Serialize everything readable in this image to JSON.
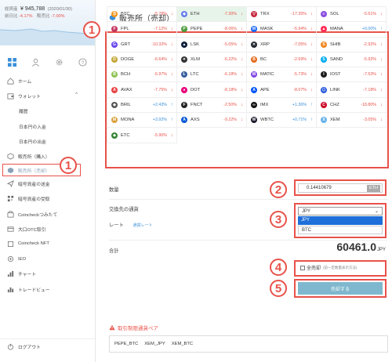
{
  "sidebar": {
    "total_label": "総資産",
    "total_value": "¥ 945,788",
    "total_date": "(2020/01/30)",
    "change_label": "前日比",
    "change_value": "-4.17%",
    "sales_label": "販売比",
    "sales_value": "-7.00%",
    "nav": [
      {
        "label": "ホーム",
        "icon": "home-icon"
      },
      {
        "label": "ウォレット",
        "icon": "wallet-icon",
        "expanded": true
      },
      {
        "label": "履歴",
        "sub": true
      },
      {
        "label": "日本円の入金",
        "sub": true
      },
      {
        "label": "日本円の出金",
        "sub": true
      },
      {
        "label": "販売所（購入）",
        "icon": "cube-icon"
      },
      {
        "label": "販売所（売却）",
        "icon": "cube-icon",
        "active": true
      },
      {
        "label": "暗号資産の送金",
        "icon": "send-icon"
      },
      {
        "label": "暗号資産の受取",
        "icon": "qr-icon"
      },
      {
        "label": "Coincheckつみたて",
        "icon": "savings-icon"
      },
      {
        "label": "大口OTC取引",
        "icon": "otc-icon"
      },
      {
        "label": "Coincheck NFT",
        "icon": "nft-icon"
      },
      {
        "label": "IEO",
        "icon": "ieo-icon"
      },
      {
        "label": "チャート",
        "icon": "chart-icon"
      },
      {
        "label": "トレードビュー",
        "icon": "tradeview-icon"
      }
    ],
    "logout": "ログアウト",
    "wallet_chevron": "^"
  },
  "badges": {
    "b1": "1",
    "b1s": "1",
    "b2": "2",
    "b3": "3",
    "b4": "4",
    "b5": "5"
  },
  "main": {
    "title": "販売所（売却）",
    "coins": [
      {
        "sym": "BTC",
        "chg": "-5.78%",
        "dir": "neg",
        "color": "#f7931a",
        "glyph": "₿"
      },
      {
        "sym": "ETH",
        "chg": "-7.30%",
        "dir": "neg",
        "color": "#627eea",
        "glyph": "◆",
        "selected": true
      },
      {
        "sym": "TRX",
        "chg": "-17.35%",
        "dir": "neg",
        "color": "#c4283f",
        "glyph": "▽"
      },
      {
        "sym": "SOL",
        "chg": "-5.61%",
        "dir": "neg",
        "color": "#8a4fe0",
        "glyph": "≡"
      },
      {
        "sym": "FPL",
        "chg": "-7.12%",
        "dir": "neg",
        "color": "#c4375e",
        "glyph": "F"
      },
      {
        "sym": "PEPE",
        "chg": "-8.06%",
        "dir": "neg",
        "color": "#4a9a3a",
        "glyph": "P"
      },
      {
        "sym": "MASK",
        "chg": "-5.94%",
        "dir": "neg",
        "color": "#1c68f3",
        "glyph": "M"
      },
      {
        "sym": "MANA",
        "chg": "+0.00%",
        "dir": "pos",
        "color": "#ff2d55",
        "glyph": "▲"
      },
      {
        "sym": "GRT",
        "chg": "-10.32%",
        "dir": "neg",
        "color": "#6747ed",
        "glyph": "G"
      },
      {
        "sym": "LSK",
        "chg": "-5.05%",
        "dir": "neg",
        "color": "#0d1e3a",
        "glyph": "▲"
      },
      {
        "sym": "XRP",
        "chg": "-7.05%",
        "dir": "neg",
        "color": "#23292f",
        "glyph": "✕"
      },
      {
        "sym": "SHIB",
        "chg": "-2.92%",
        "dir": "neg",
        "color": "#f0871f",
        "glyph": "S"
      },
      {
        "sym": "DOGE",
        "chg": "-6.64%",
        "dir": "neg",
        "color": "#c2a633",
        "glyph": "D"
      },
      {
        "sym": "XLM",
        "chg": "-6.22%",
        "dir": "neg",
        "color": "#333333",
        "glyph": "✦"
      },
      {
        "sym": "BC",
        "chg": "-2.69%",
        "dir": "neg",
        "color": "#e36a1a",
        "glyph": "B"
      },
      {
        "sym": "SAND",
        "chg": "-5.92%",
        "dir": "neg",
        "color": "#00adef",
        "glyph": "S"
      },
      {
        "sym": "BCH",
        "chg": "-5.97%",
        "dir": "neg",
        "color": "#8dc351",
        "glyph": "B"
      },
      {
        "sym": "LTC",
        "chg": "-6.18%",
        "dir": "neg",
        "color": "#345d9d",
        "glyph": "Ł"
      },
      {
        "sym": "MATIC",
        "chg": "-5.73%",
        "dir": "neg",
        "color": "#8247e5",
        "glyph": "M"
      },
      {
        "sym": "IOST",
        "chg": "-7.53%",
        "dir": "neg",
        "color": "#1c1c1c",
        "glyph": "I"
      },
      {
        "sym": "AVAX",
        "chg": "-7.75%",
        "dir": "neg",
        "color": "#e84142",
        "glyph": "A"
      },
      {
        "sym": "DOT",
        "chg": "-8.18%",
        "dir": "neg",
        "color": "#e6007a",
        "glyph": "●"
      },
      {
        "sym": "APE",
        "chg": "-8.07%",
        "dir": "neg",
        "color": "#0054f9",
        "glyph": "A"
      },
      {
        "sym": "LINK",
        "chg": "-7.18%",
        "dir": "neg",
        "color": "#2a5ada",
        "glyph": "⬡"
      },
      {
        "sym": "BRIL",
        "chg": "+2.43%",
        "dir": "pos",
        "color": "#555555",
        "glyph": "◆"
      },
      {
        "sym": "FNCT",
        "chg": "-2.50%",
        "dir": "neg",
        "color": "#222222",
        "glyph": "F"
      },
      {
        "sym": "IMX",
        "chg": "+1.36%",
        "dir": "pos",
        "color": "#111111",
        "glyph": "∞"
      },
      {
        "sym": "CHZ",
        "chg": "-18.80%",
        "dir": "neg",
        "color": "#cd0124",
        "glyph": "C"
      },
      {
        "sym": "MONA",
        "chg": "+3.92%",
        "dir": "pos",
        "color": "#d9a03b",
        "glyph": "M"
      },
      {
        "sym": "AXS",
        "chg": "-9.22%",
        "dir": "neg",
        "color": "#0055d5",
        "glyph": "A"
      },
      {
        "sym": "WBTC",
        "chg": "+0.71%",
        "dir": "pos",
        "color": "#201a2d",
        "glyph": "W"
      },
      {
        "sym": "XEM",
        "chg": "-3.05%",
        "dir": "neg",
        "color": "#67b2e8",
        "glyph": "X"
      },
      {
        "sym": "ETC",
        "chg": "-5.90%",
        "dir": "neg",
        "color": "#328332",
        "glyph": "◆"
      }
    ],
    "arrow_down": "↓",
    "arrow_up": "↑",
    "qty_label": "数量",
    "qty_value": "0.14410679",
    "qty_unit": "ETH",
    "currency_label": "交換先の通貨",
    "currency_selected": "JPY",
    "currency_options": [
      "JPY",
      "BTC"
    ],
    "rate_label": "レート",
    "rate_link": "通貨レート",
    "total_label": "合計",
    "total_value": "60461.0",
    "total_unit": "JPY",
    "sell_all_label": "全売却",
    "sell_all_note": "(前一定数量表示方法)",
    "submit_label": "売却する",
    "restricted_title": "取引制限通貨ペア",
    "restricted_pairs": [
      "PEPE_BTC",
      "XEM_JPY",
      "XEM_BTC"
    ]
  },
  "colors": {
    "accent": "#e8524a",
    "link": "#3a8fd8",
    "button": "#7fb8ce",
    "selected_cell": "#e7f4e9"
  }
}
